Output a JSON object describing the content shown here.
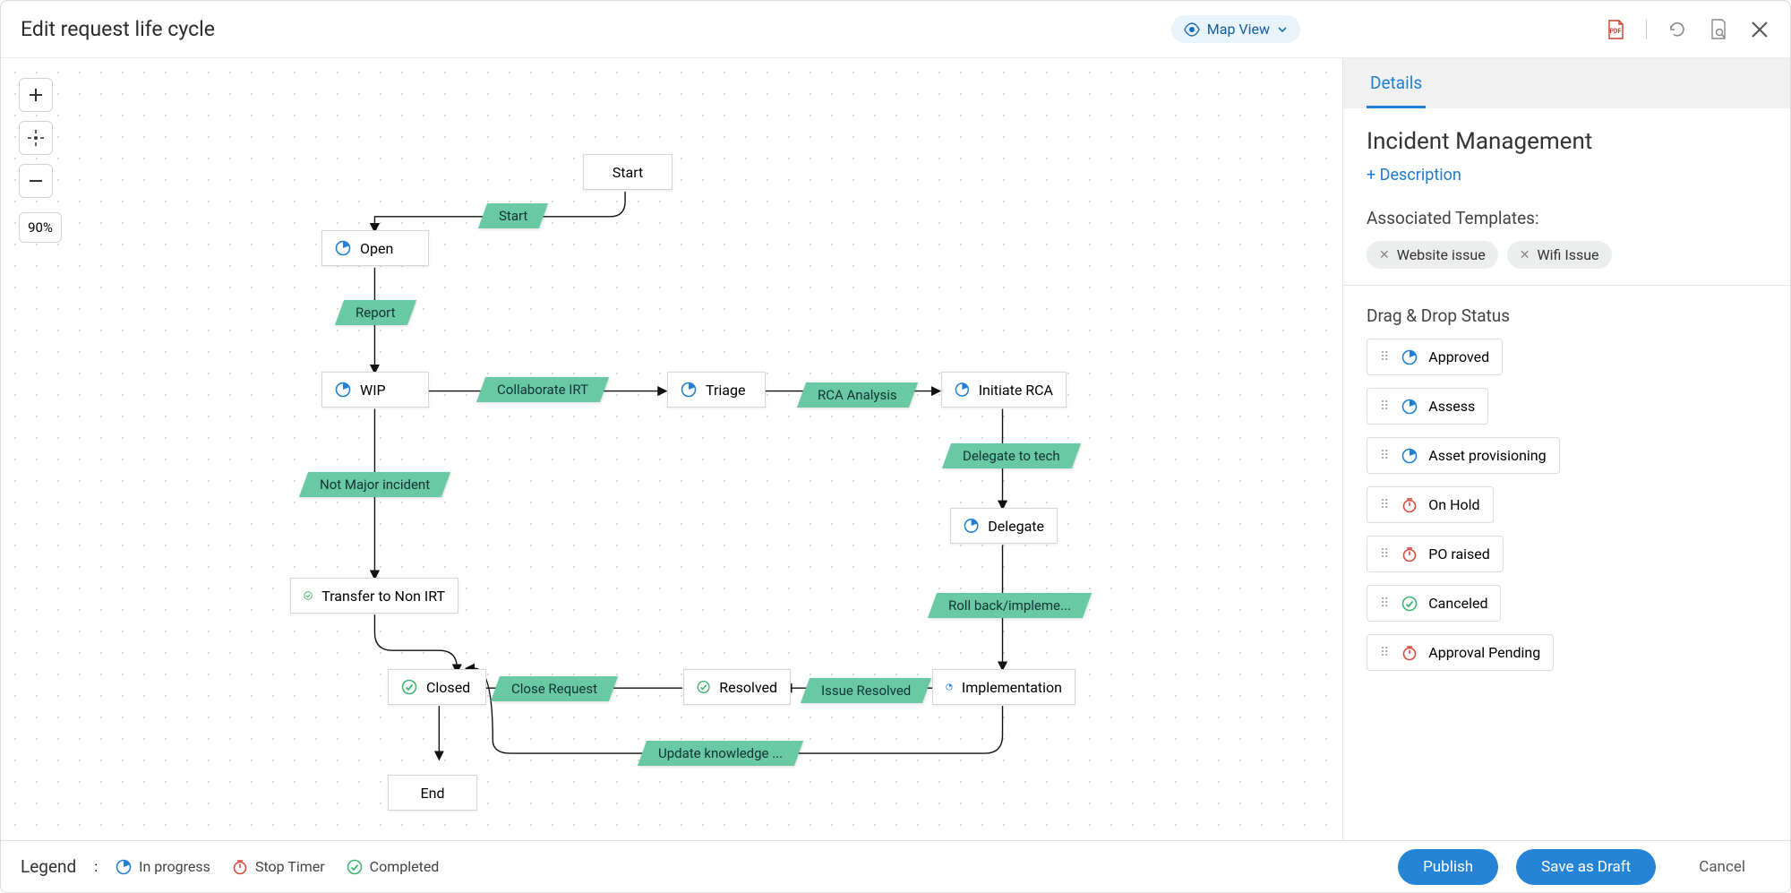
{
  "header": {
    "title": "Edit request life cycle",
    "view_label": "Map View"
  },
  "zoom": {
    "value": "90%"
  },
  "nodes": {
    "start": "Start",
    "open": "Open",
    "wip": "WIP",
    "triage": "Triage",
    "initiate_rca": "Initiate RCA",
    "delegate": "Delegate",
    "transfer": "Transfer to Non IRT",
    "implementation": "Implementation",
    "resolved": "Resolved",
    "closed": "Closed",
    "end": "End"
  },
  "edges": {
    "start": "Start",
    "report": "Report",
    "collaborate": "Collaborate IRT",
    "rca": "RCA Analysis",
    "delegate_tech": "Delegate to tech",
    "not_major": "Not Major incident",
    "rollback": "Roll back/impleme...",
    "issue_resolved": "Issue Resolved",
    "close_request": "Close Request",
    "update_kb": "Update knowledge ..."
  },
  "side": {
    "tab": "Details",
    "title": "Incident Management",
    "add_desc": "+ Description",
    "templates_label": "Associated Templates:",
    "templates": [
      "Website issue",
      "Wifi Issue"
    ],
    "dragdrop_label": "Drag & Drop Status",
    "statuses": [
      {
        "label": "Approved",
        "type": "progress"
      },
      {
        "label": "Assess",
        "type": "progress"
      },
      {
        "label": "Asset provisioning",
        "type": "progress"
      },
      {
        "label": "On Hold",
        "type": "timer"
      },
      {
        "label": "PO raised",
        "type": "timer"
      },
      {
        "label": "Canceled",
        "type": "done"
      },
      {
        "label": "Approval Pending",
        "type": "timer"
      }
    ]
  },
  "legend": {
    "label": "Legend",
    "sep": ":",
    "items": [
      {
        "label": "In progress",
        "type": "progress"
      },
      {
        "label": "Stop Timer",
        "type": "timer"
      },
      {
        "label": "Completed",
        "type": "done"
      }
    ]
  },
  "footer": {
    "publish": "Publish",
    "draft": "Save as Draft",
    "cancel": "Cancel"
  }
}
